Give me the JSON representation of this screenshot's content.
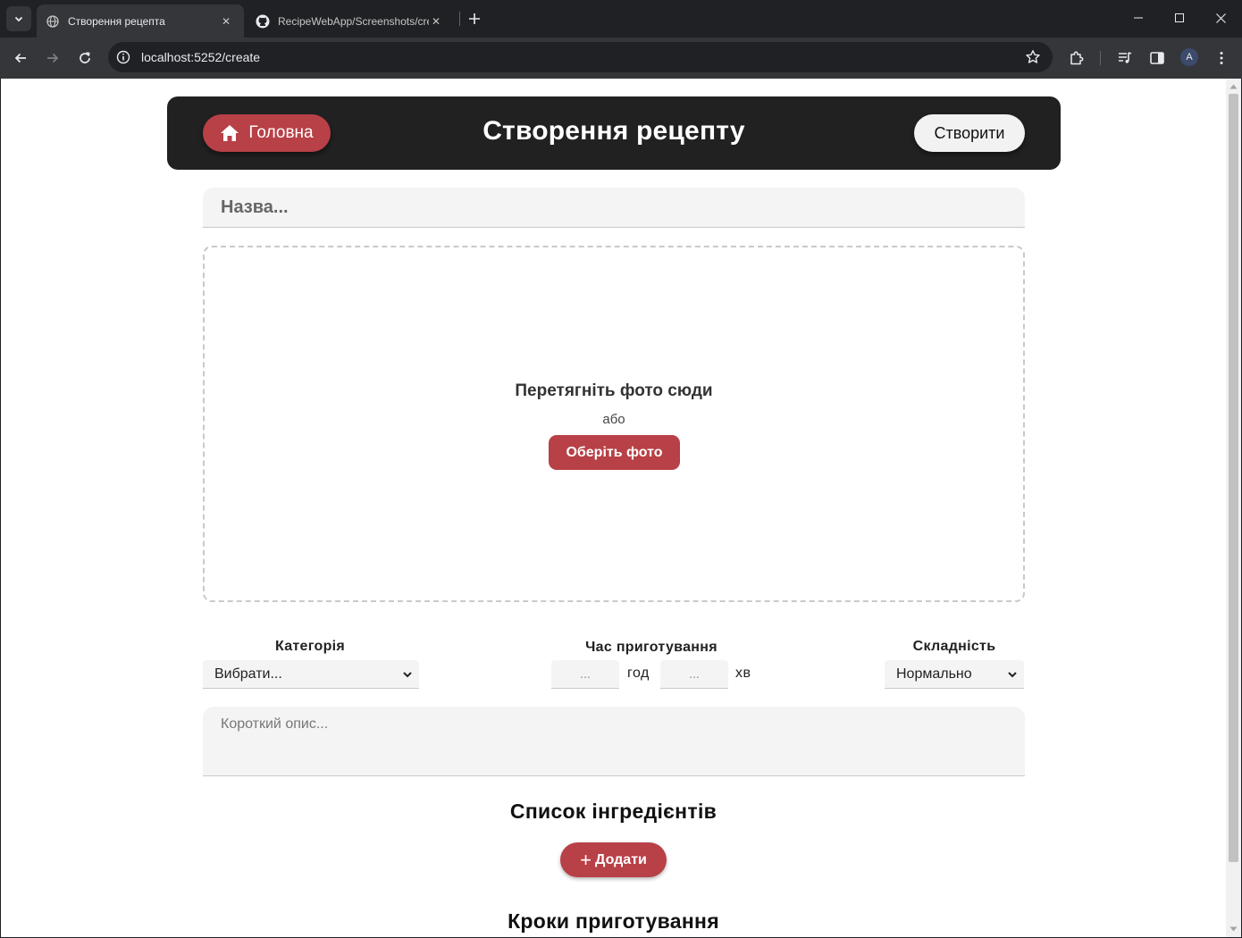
{
  "browser": {
    "tabs": [
      {
        "title": "Створення рецепта",
        "active": true,
        "icon": "globe-icon"
      },
      {
        "title": "RecipeWebApp/Screenshots/create",
        "active": false,
        "icon": "github-icon"
      }
    ],
    "url": "localhost:5252/create",
    "profile_initial": "A"
  },
  "header": {
    "home_label": "Головна",
    "title": "Створення рецепту",
    "create_label": "Створити"
  },
  "form": {
    "name_placeholder": "Назва...",
    "dropzone": {
      "title": "Перетягніть фото сюди",
      "or": "або",
      "choose_label": "Оберіть фото"
    },
    "category": {
      "label": "Категорія",
      "selected": "Вибрати..."
    },
    "cook_time": {
      "label": "Час приготування",
      "hours_placeholder": "...",
      "hours_unit": "год",
      "minutes_placeholder": "...",
      "minutes_unit": "хв"
    },
    "difficulty": {
      "label": "Складність",
      "selected": "Нормально"
    },
    "description_placeholder": "Короткий опис...",
    "ingredients": {
      "title": "Список інгредієнтів",
      "add_label": "Додати"
    },
    "steps": {
      "title": "Кроки приготування"
    }
  },
  "colors": {
    "accent": "#b84047",
    "header_bg": "#212121",
    "input_bg": "#f4f4f4"
  }
}
